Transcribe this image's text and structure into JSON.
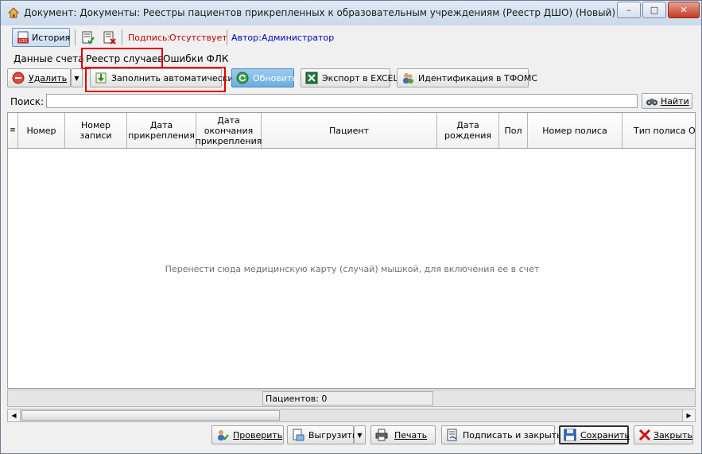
{
  "window": {
    "title": "Документ: Документы: Реестры пациентов прикрепленных к образовательным учреждениям (Реестр ДШО) (Новый)",
    "minimize_glyph": "–",
    "maximize_glyph": "□",
    "close_glyph": "✕"
  },
  "infobar": {
    "history_label": "История",
    "signature_label": "Подпись:",
    "signature_value": "Отсутствует",
    "author_label": "Автор:",
    "author_value": "Администратор",
    "signature_value_color": "#c00000",
    "author_color": "#0000c0"
  },
  "tabs": [
    {
      "label": "Данные счета"
    },
    {
      "label": "Реестр случаев"
    },
    {
      "label": "Ошибки ФЛК"
    }
  ],
  "toolbar": {
    "delete_label": "Удалить",
    "autofill_label": "Заполнить автоматически",
    "refresh_label": "Обновить",
    "export_label": "Экспорт в EXCEL",
    "identify_label": "Идентификация в ТФОМС"
  },
  "search": {
    "label": "Поиск:",
    "value": "",
    "find_label": "Найти"
  },
  "table": {
    "columns": [
      "Номер",
      "Номер записи",
      "Дата\nприкрепления",
      "Дата\nокончания\nприкрепления",
      "Пациент",
      "Дата\nрождения",
      "Пол",
      "Номер полиса",
      "Тип полиса ОМС"
    ],
    "empty_message": "Перенести сюда медицинскую карту (случай) мышкой, для включения ее в счет"
  },
  "footer": {
    "patients_count": "Пациентов: 0"
  },
  "bottom_buttons": {
    "check_label": "Проверить",
    "upload_label": "Выгрузить",
    "print_label": "Печать",
    "sign_close_label": "Подписать и закрыть",
    "save_label": "Сохранить",
    "close_label": "Закрыть"
  },
  "icons": {
    "window": "app-home-icon",
    "history": "log-icon",
    "sign": "sign-document-icon",
    "unsign": "unsign-document-icon",
    "delete": "delete-icon",
    "autofill": "download-fill-icon",
    "refresh": "refresh-icon",
    "excel": "excel-icon",
    "identify": "users-icon",
    "find": "binoculars-icon",
    "check": "check-users-icon",
    "upload": "upload-document-icon",
    "print": "printer-icon",
    "sign_close": "sign-close-icon",
    "save": "save-icon",
    "close": "close-icon"
  }
}
